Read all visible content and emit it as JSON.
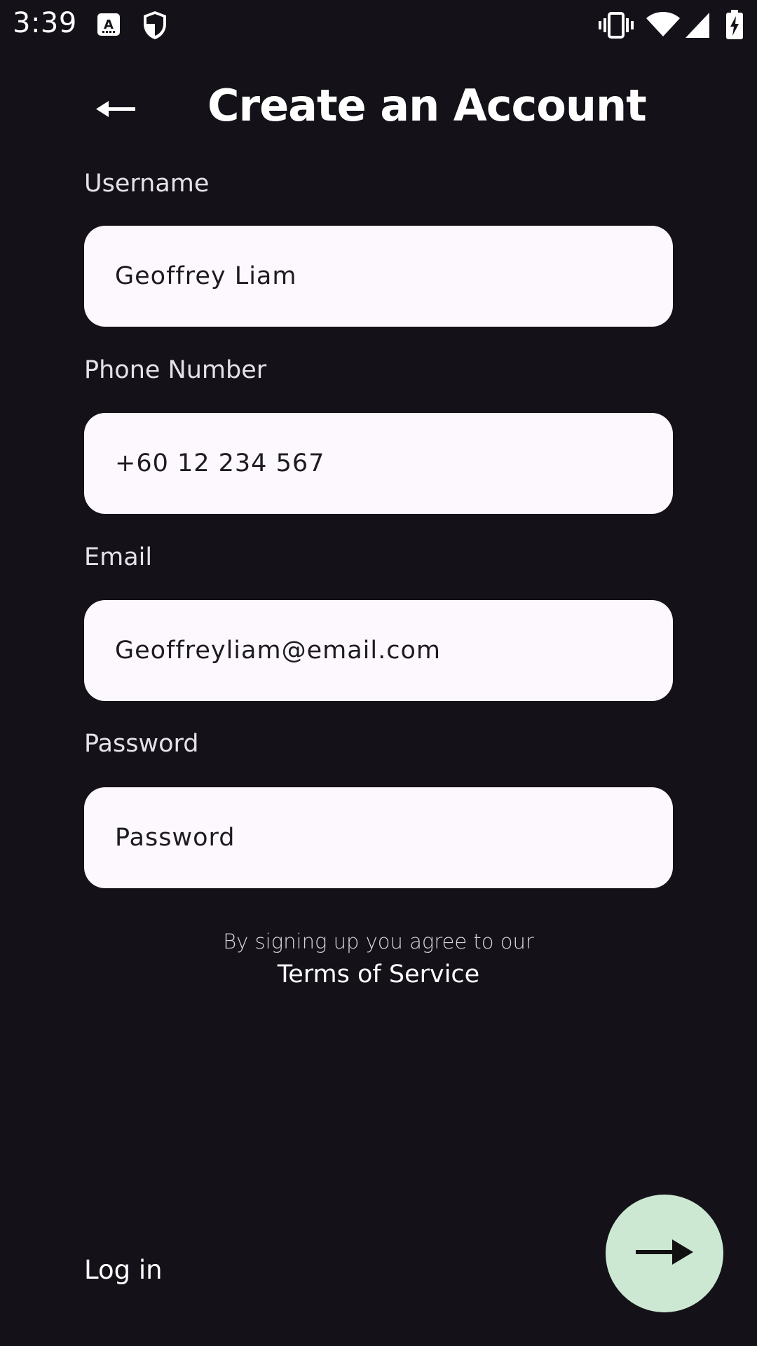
{
  "status_bar": {
    "time": "3:39",
    "icons": [
      "keyboard-notification-icon",
      "shield-icon",
      "vibrate-icon",
      "wifi-icon",
      "cell-signal-icon",
      "battery-charging-icon"
    ]
  },
  "header": {
    "title": "Create an Account",
    "back_icon": "arrow-back-icon"
  },
  "form": {
    "username": {
      "label": "Username",
      "value": "Geoffrey Liam"
    },
    "phone": {
      "label": "Phone Number",
      "value": "+60 12 234 567"
    },
    "email": {
      "label": "Email",
      "value": "Geoffreyliam@email.com"
    },
    "password": {
      "label": "Password",
      "placeholder": "Password",
      "value": ""
    }
  },
  "terms": {
    "text": "By signing up you agree to our",
    "link": "Terms of Service"
  },
  "footer": {
    "login_label": "Log in",
    "next_icon": "arrow-forward-icon"
  },
  "colors": {
    "background": "#141218",
    "input_fill": "#fdf8fd",
    "fab_fill": "#cce8d3",
    "text_primary": "#ffffff"
  }
}
